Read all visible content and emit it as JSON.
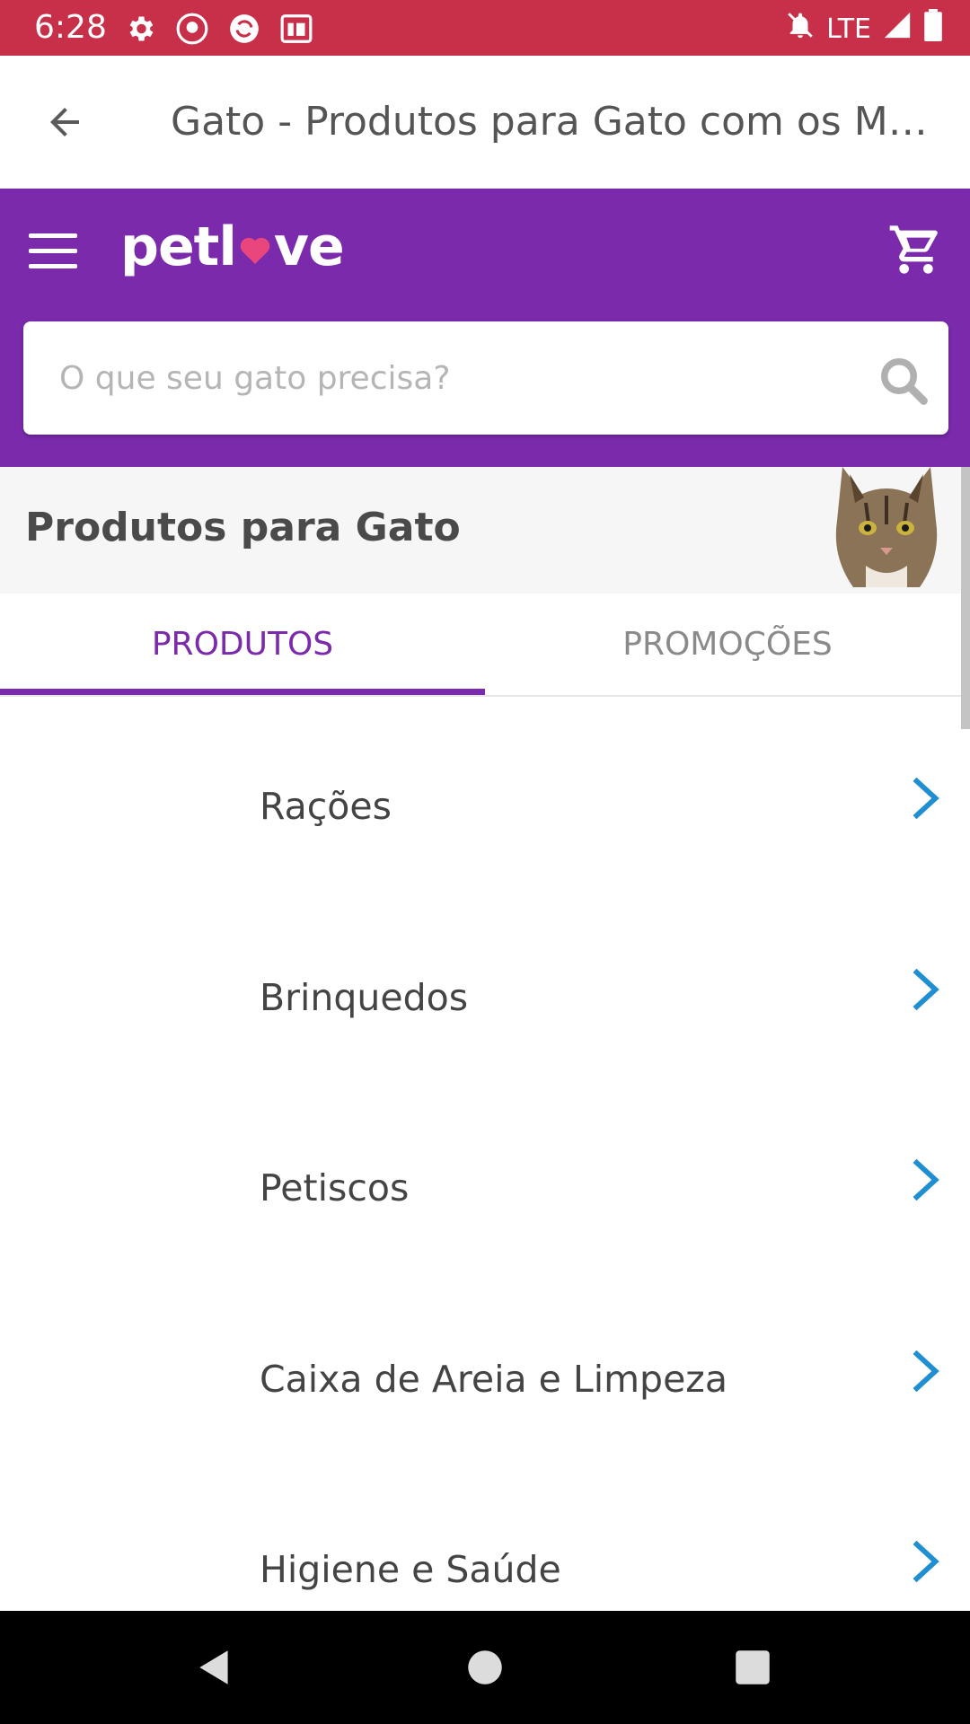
{
  "status_bar": {
    "time": "6:28",
    "network": "LTE",
    "icons": [
      "settings-icon",
      "app-badge-icon",
      "sync-icon",
      "rb-app-icon",
      "notifications-off-icon",
      "signal-icon",
      "battery-icon"
    ]
  },
  "title_bar": {
    "title": "Gato - Produtos para Gato com os Melh..."
  },
  "header": {
    "logo_text": "petlove",
    "search_placeholder": "O que seu gato precisa?",
    "accent_color": "#7a2aaa"
  },
  "category": {
    "title": "Produtos para Gato"
  },
  "tabs": [
    {
      "label": "PRODUTOS",
      "active": true
    },
    {
      "label": "PROMOÇÕES",
      "active": false
    }
  ],
  "list": {
    "items": [
      {
        "label": "Rações"
      },
      {
        "label": "Brinquedos"
      },
      {
        "label": "Petiscos"
      },
      {
        "label": "Caixa de Areia e Limpeza"
      },
      {
        "label": "Higiene e Saúde"
      }
    ],
    "chevron_color": "#1f8fd1"
  }
}
